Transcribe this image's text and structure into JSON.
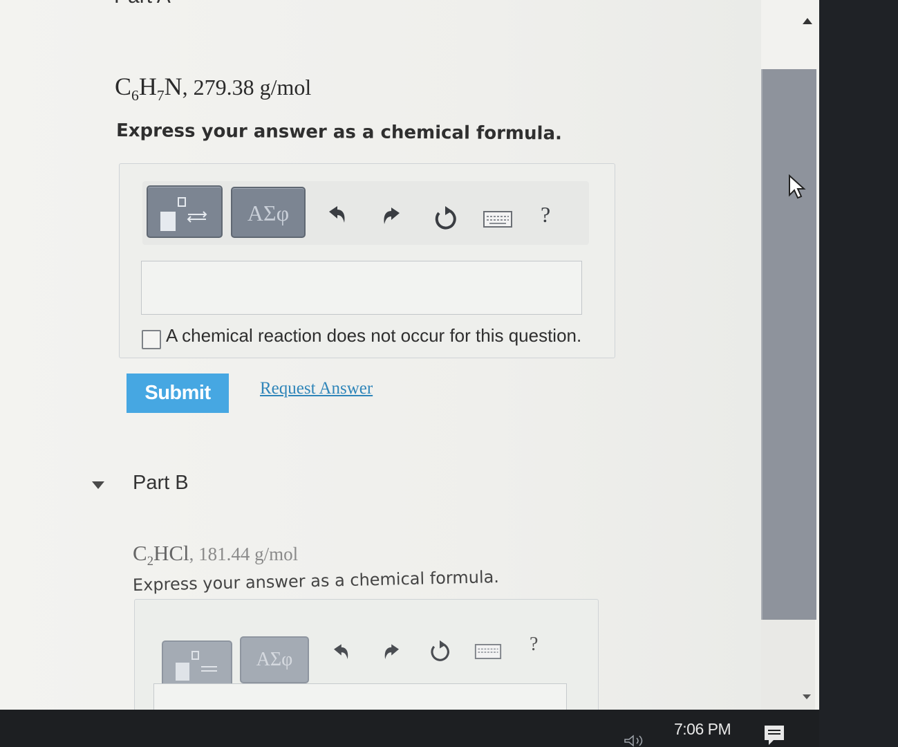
{
  "part_a": {
    "heading": "Part A",
    "formula_parts": [
      "C",
      "6",
      "H",
      "7",
      "N"
    ],
    "molar_mass": ", 279.38 g/mol",
    "instruction": "Express your answer as a chemical formula.",
    "toolbar": {
      "greek_label": "ΑΣφ",
      "help_label": "?"
    },
    "answer_value": "",
    "no_reaction_label": "A chemical reaction does not occur for this question.",
    "submit_label": "Submit",
    "request_answer_label": "Request Answer"
  },
  "part_b": {
    "heading": "Part B",
    "formula_parts": [
      "C",
      "2",
      "HCl"
    ],
    "molar_mass": ", 181.44 g/mol",
    "instruction": "Express your answer as a chemical formula.",
    "toolbar": {
      "greek_label": "ΑΣφ",
      "help_label": "?"
    }
  },
  "taskbar": {
    "time": "7:06 PM"
  },
  "icons": {
    "template": "template-icon",
    "undo": "undo-icon",
    "redo": "redo-icon",
    "reset": "reset-icon",
    "keyboard": "keyboard-icon",
    "help": "help-icon",
    "collapse": "caret-down-icon",
    "scroll_up": "scroll-up-icon",
    "scroll_down": "scroll-down-icon",
    "cursor": "cursor-icon",
    "speaker": "speaker-icon",
    "notification": "notification-icon"
  },
  "colors": {
    "submit": "#46a7e2",
    "link": "#2f85b9",
    "toolbar_button": "#7c8592"
  }
}
